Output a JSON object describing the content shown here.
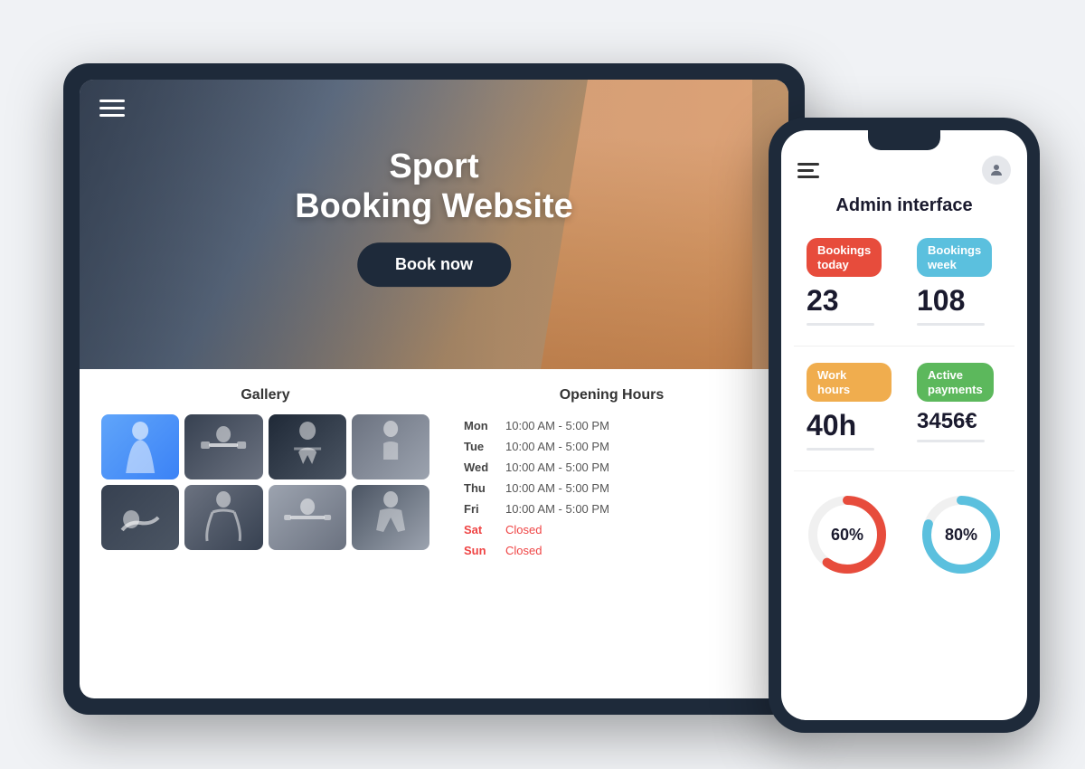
{
  "scene": {
    "tablet": {
      "hero": {
        "title_line1": "Sport",
        "title_line2": "Booking Website",
        "button_label": "Book now"
      },
      "gallery": {
        "heading": "Gallery",
        "images": [
          {
            "id": "g1",
            "alt": "fitness woman"
          },
          {
            "id": "g2",
            "alt": "gym workout"
          },
          {
            "id": "g3",
            "alt": "weight training"
          },
          {
            "id": "g4",
            "alt": "gym equipment"
          },
          {
            "id": "g5",
            "alt": "floor exercise"
          },
          {
            "id": "g6",
            "alt": "yoga pose"
          },
          {
            "id": "g7",
            "alt": "barbell lift"
          },
          {
            "id": "g8",
            "alt": "squat exercise"
          }
        ]
      },
      "opening_hours": {
        "heading": "Opening Hours",
        "days": [
          {
            "day": "Mon",
            "hours": "10:00 AM - 5:00 PM",
            "closed": false
          },
          {
            "day": "Tue",
            "hours": "10:00 AM - 5:00 PM",
            "closed": false
          },
          {
            "day": "Wed",
            "hours": "10:00 AM - 5:00 PM",
            "closed": false
          },
          {
            "day": "Thu",
            "hours": "10:00 AM - 5:00 PM",
            "closed": false
          },
          {
            "day": "Fri",
            "hours": "10:00 AM - 5:00 PM",
            "closed": false
          },
          {
            "day": "Sat",
            "hours": "Closed",
            "closed": true
          },
          {
            "day": "Sun",
            "hours": "Closed",
            "closed": true
          }
        ]
      }
    },
    "phone": {
      "admin_title": "Admin interface",
      "stats": [
        {
          "id": "bookings-today",
          "label": "Bookings\ntoday",
          "value": "23",
          "color_class": "label-red"
        },
        {
          "id": "bookings-week",
          "label": "Bookings\nweek",
          "value": "108",
          "color_class": "label-blue"
        },
        {
          "id": "work-hours",
          "label": "Work hours",
          "value": "40h",
          "color_class": "label-yellow"
        },
        {
          "id": "active-payments",
          "label": "Active\npayments",
          "value": "3456€",
          "color_class": "label-green"
        }
      ],
      "charts": [
        {
          "id": "chart1",
          "percent": 60,
          "color": "#e74c3c",
          "track": "#f0f0f0"
        },
        {
          "id": "chart2",
          "percent": 80,
          "color": "#5bc0de",
          "track": "#f0f0f0"
        }
      ]
    }
  }
}
